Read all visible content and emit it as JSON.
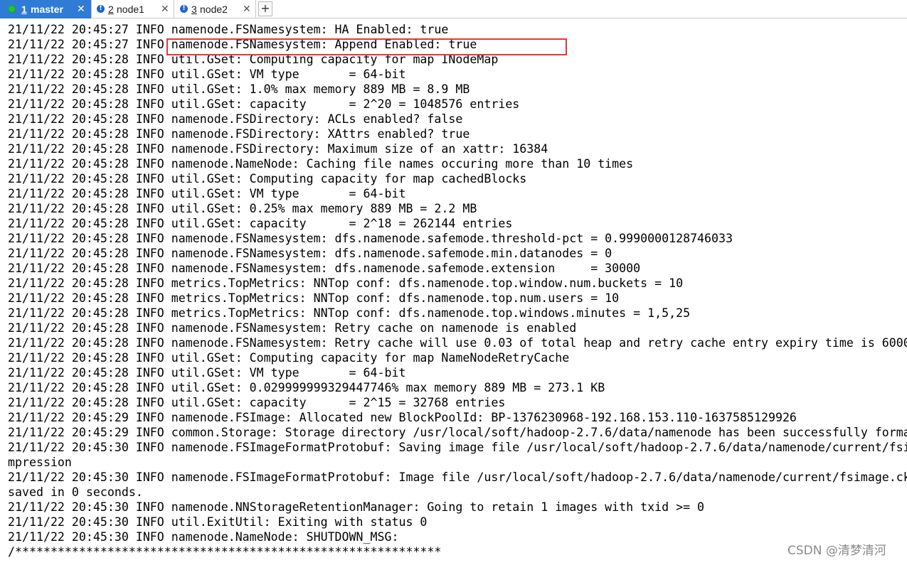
{
  "tabs": [
    {
      "number": "1",
      "name": "master",
      "status": "connected",
      "active": true,
      "close": "✕"
    },
    {
      "number": "2",
      "name": "node1",
      "status": "warning",
      "active": false,
      "close": "✕"
    },
    {
      "number": "3",
      "name": "node2",
      "status": "warning",
      "active": false,
      "close": "✕"
    }
  ],
  "new_tab_label": "+",
  "terminal_lines": [
    "21/11/22 20:45:27 INFO namenode.FSNamesystem: HA Enabled: true",
    "21/11/22 20:45:27 INFO namenode.FSNamesystem: Append Enabled: true",
    "21/11/22 20:45:28 INFO util.GSet: Computing capacity for map INodeMap",
    "21/11/22 20:45:28 INFO util.GSet: VM type       = 64-bit",
    "21/11/22 20:45:28 INFO util.GSet: 1.0% max memory 889 MB = 8.9 MB",
    "21/11/22 20:45:28 INFO util.GSet: capacity      = 2^20 = 1048576 entries",
    "21/11/22 20:45:28 INFO namenode.FSDirectory: ACLs enabled? false",
    "21/11/22 20:45:28 INFO namenode.FSDirectory: XAttrs enabled? true",
    "21/11/22 20:45:28 INFO namenode.FSDirectory: Maximum size of an xattr: 16384",
    "21/11/22 20:45:28 INFO namenode.NameNode: Caching file names occuring more than 10 times",
    "21/11/22 20:45:28 INFO util.GSet: Computing capacity for map cachedBlocks",
    "21/11/22 20:45:28 INFO util.GSet: VM type       = 64-bit",
    "21/11/22 20:45:28 INFO util.GSet: 0.25% max memory 889 MB = 2.2 MB",
    "21/11/22 20:45:28 INFO util.GSet: capacity      = 2^18 = 262144 entries",
    "21/11/22 20:45:28 INFO namenode.FSNamesystem: dfs.namenode.safemode.threshold-pct = 0.9990000128746033",
    "21/11/22 20:45:28 INFO namenode.FSNamesystem: dfs.namenode.safemode.min.datanodes = 0",
    "21/11/22 20:45:28 INFO namenode.FSNamesystem: dfs.namenode.safemode.extension     = 30000",
    "21/11/22 20:45:28 INFO metrics.TopMetrics: NNTop conf: dfs.namenode.top.window.num.buckets = 10",
    "21/11/22 20:45:28 INFO metrics.TopMetrics: NNTop conf: dfs.namenode.top.num.users = 10",
    "21/11/22 20:45:28 INFO metrics.TopMetrics: NNTop conf: dfs.namenode.top.windows.minutes = 1,5,25",
    "21/11/22 20:45:28 INFO namenode.FSNamesystem: Retry cache on namenode is enabled",
    "21/11/22 20:45:28 INFO namenode.FSNamesystem: Retry cache will use 0.03 of total heap and retry cache entry expiry time is 6000",
    "21/11/22 20:45:28 INFO util.GSet: Computing capacity for map NameNodeRetryCache",
    "21/11/22 20:45:28 INFO util.GSet: VM type       = 64-bit",
    "21/11/22 20:45:28 INFO util.GSet: 0.029999999329447746% max memory 889 MB = 273.1 KB",
    "21/11/22 20:45:28 INFO util.GSet: capacity      = 2^15 = 32768 entries",
    "21/11/22 20:45:29 INFO namenode.FSImage: Allocated new BlockPoolId: BP-1376230968-192.168.153.110-1637585129926",
    "21/11/22 20:45:29 INFO common.Storage: Storage directory /usr/local/soft/hadoop-2.7.6/data/namenode has been successfully forma",
    "21/11/22 20:45:30 INFO namenode.FSImageFormatProtobuf: Saving image file /usr/local/soft/hadoop-2.7.6/data/namenode/current/fsi",
    "mpression",
    "21/11/22 20:45:30 INFO namenode.FSImageFormatProtobuf: Image file /usr/local/soft/hadoop-2.7.6/data/namenode/current/fsimage.ck",
    "saved in 0 seconds.",
    "21/11/22 20:45:30 INFO namenode.NNStorageRetentionManager: Going to retain 1 images with txid >= 0",
    "21/11/22 20:45:30 INFO util.ExitUtil: Exiting with status 0",
    "21/11/22 20:45:30 INFO namenode.NameNode: SHUTDOWN_MSG:",
    "/************************************************************"
  ],
  "watermark": "CSDN @清梦清河",
  "colors": {
    "active_tab": "#2f7bd6",
    "connected_status": "#22c238",
    "warning_status": "#1e66c8",
    "highlight_box": "#e0393e"
  }
}
